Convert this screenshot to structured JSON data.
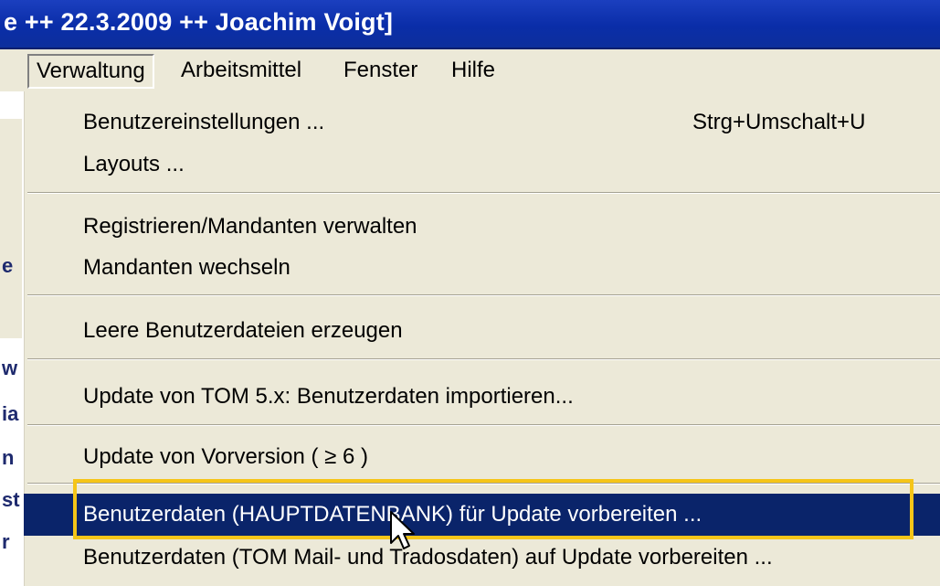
{
  "window": {
    "title": "e ++ 22.3.2009 ++ Joachim Voigt]"
  },
  "menubar": {
    "items": [
      {
        "label": "Verwaltung",
        "active": true
      },
      {
        "label": "Arbeitsmittel",
        "active": false
      },
      {
        "label": "Fenster",
        "active": false
      },
      {
        "label": "Hilfe",
        "active": false
      }
    ]
  },
  "left_strip": {
    "fragments": [
      "e",
      "w",
      "ia",
      "n",
      "st",
      "r"
    ]
  },
  "dropdown": {
    "items": [
      {
        "label": "Benutzereinstellungen ...",
        "shortcut": "Strg+Umschalt+U"
      },
      {
        "label": "Layouts ..."
      },
      {
        "label": "Registrieren/Mandanten verwalten"
      },
      {
        "label": "Mandanten wechseln"
      },
      {
        "label": "Leere Benutzerdateien erzeugen"
      },
      {
        "label": "Update von TOM 5.x: Benutzerdaten importieren..."
      },
      {
        "label": "Update von Vorversion ( ≥ 6 )"
      },
      {
        "label": "Benutzerdaten (HAUPTDATENBANK) für Update vorbereiten ...",
        "highlighted": true
      },
      {
        "label": "Benutzerdaten (TOM Mail- und Tradosdaten) auf Update vorbereiten ..."
      }
    ]
  },
  "colors": {
    "titlebar": "#0a2da8",
    "menu_bg": "#ece9d8",
    "highlight": "#0a246a",
    "focus_outline": "#f5c518"
  }
}
